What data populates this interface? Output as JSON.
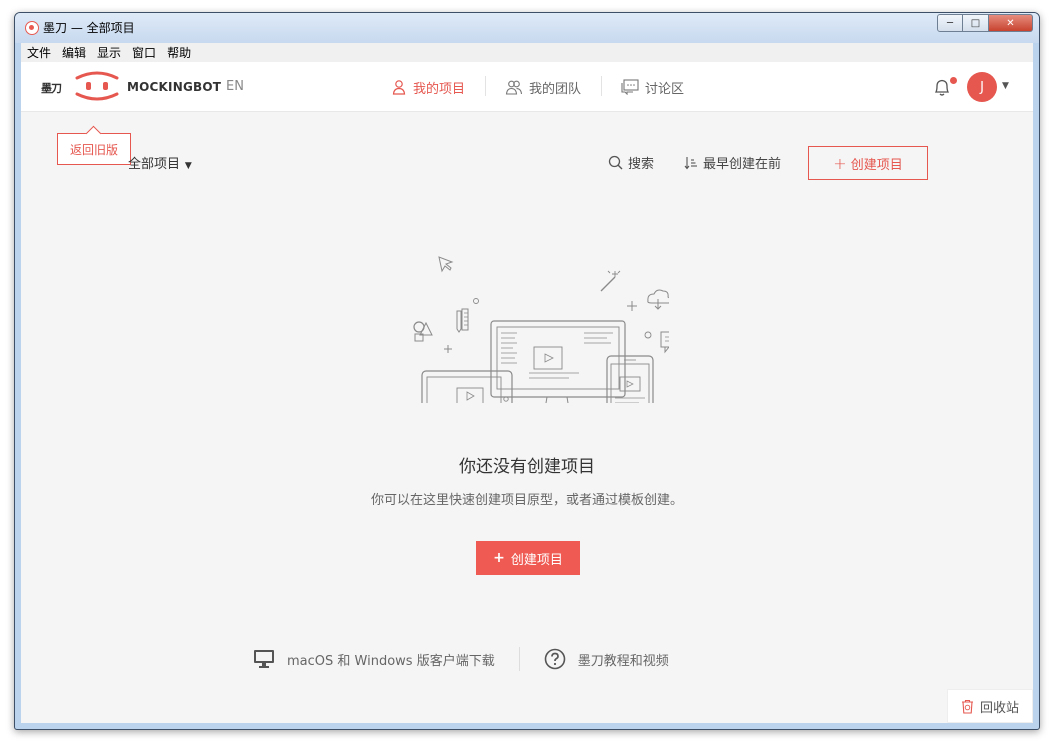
{
  "window": {
    "title": "墨刀 — 全部项目"
  },
  "menu": [
    "文件",
    "编辑",
    "显示",
    "窗口",
    "帮助"
  ],
  "header": {
    "brand_cn": "墨刀",
    "brand_en": "MOCKINGBOT",
    "lang": "EN",
    "nav": [
      {
        "label": "我的项目",
        "icon": "user-icon",
        "active": true
      },
      {
        "label": "我的团队",
        "icon": "team-icon",
        "active": false
      },
      {
        "label": "讨论区",
        "icon": "chat-icon",
        "active": false
      }
    ],
    "avatar_initial": "J",
    "accent": "#e5574f"
  },
  "tooltip": {
    "label": "返回旧版"
  },
  "toolbar": {
    "filter": "全部项目",
    "search": "搜索",
    "sort": "最早创建在前",
    "create": "创建项目"
  },
  "empty": {
    "title": "你还没有创建项目",
    "desc": "你可以在这里快速创建项目原型，或者通过模板创建。",
    "create": "创建项目"
  },
  "footer": {
    "download": "macOS 和 Windows 版客户端下载",
    "tutorial": "墨刀教程和视频"
  },
  "recycle": "回收站"
}
